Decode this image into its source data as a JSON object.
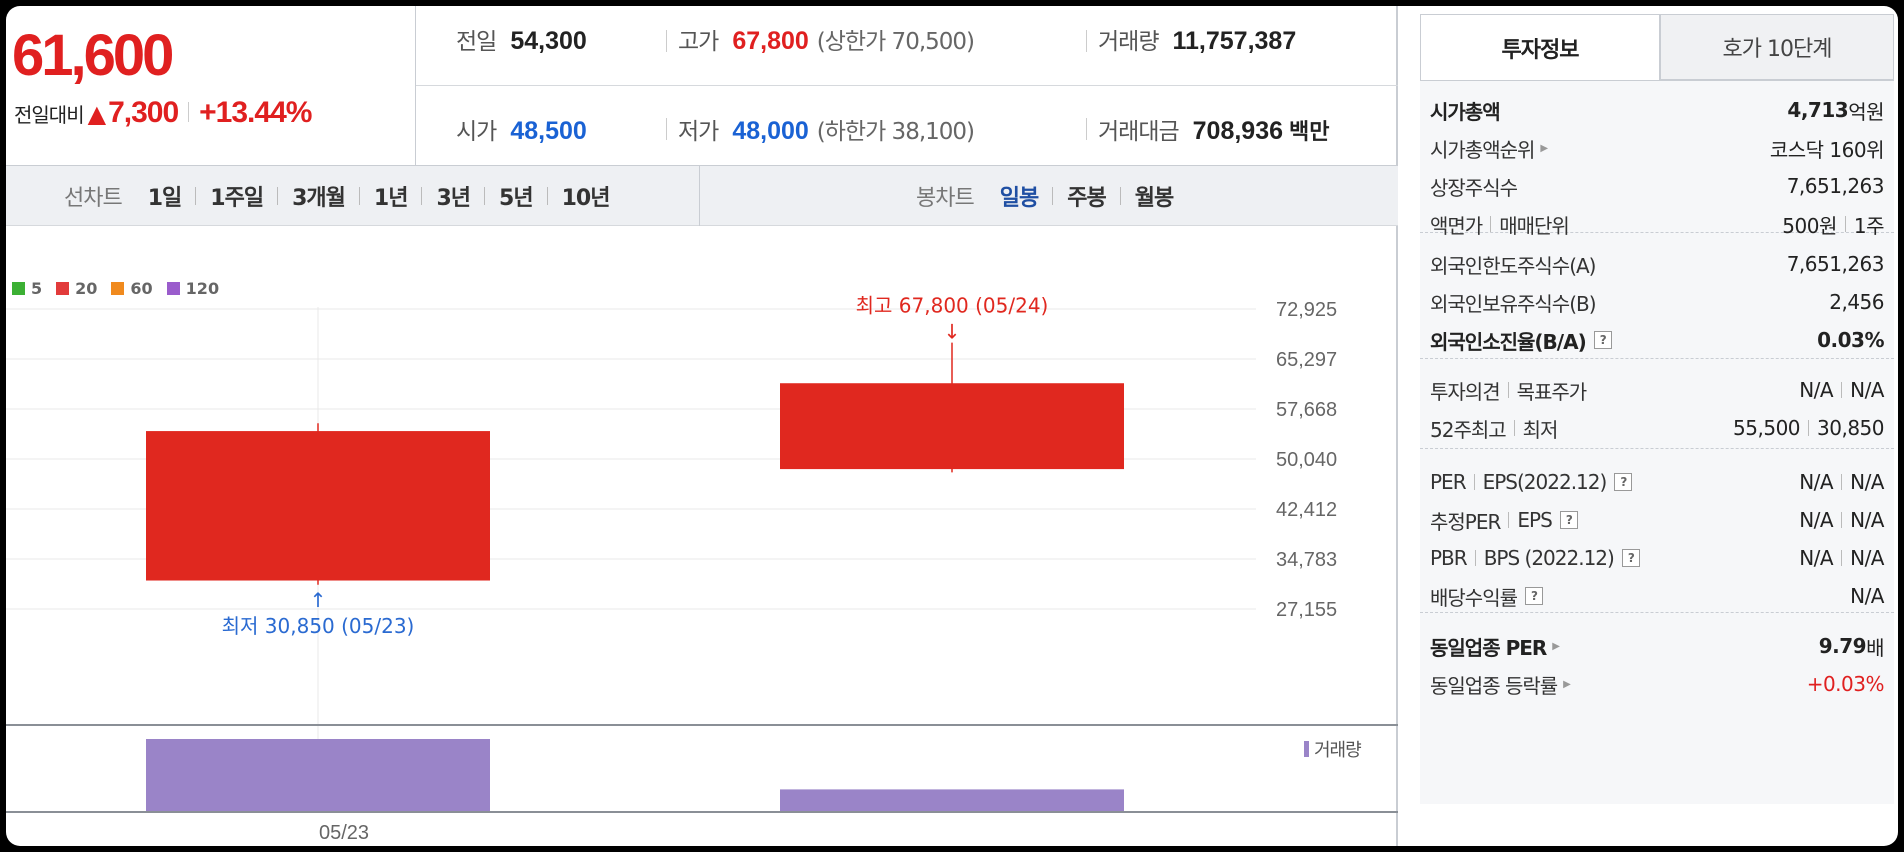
{
  "quote": {
    "price": "61,600",
    "change_label": "전일대비",
    "change_arrow": "▲",
    "change_amount": "7,300",
    "change_rate": "+13.44%",
    "prev_label": "전일",
    "prev_value": "54,300",
    "high_label": "고가",
    "high_value": "67,800",
    "upper_limit": "(상한가 70,500)",
    "volume_label": "거래량",
    "volume_value": "11,757,387",
    "open_label": "시가",
    "open_value": "48,500",
    "low_label": "저가",
    "low_value": "48,000",
    "lower_limit": "(하한가 38,100)",
    "amount_label": "거래대금",
    "amount_value": "708,936",
    "amount_unit": "백만"
  },
  "toolbar": {
    "line_title": "선차트",
    "periods": [
      "1일",
      "1주일",
      "3개월",
      "1년",
      "3년",
      "5년",
      "10년"
    ],
    "candle_title": "봉차트",
    "candles": [
      "일봉",
      "주봉",
      "월봉"
    ],
    "active_candle": "일봉"
  },
  "legend": [
    {
      "label": "5",
      "color": "#3cb034"
    },
    {
      "label": "20",
      "color": "#e23b3b"
    },
    {
      "label": "60",
      "color": "#f08a1e"
    },
    {
      "label": "120",
      "color": "#9a5ccc"
    }
  ],
  "chart_data": {
    "type": "candlestick",
    "y_ticks": [
      "72,925",
      "65,297",
      "57,668",
      "50,040",
      "42,412",
      "34,783",
      "27,155"
    ],
    "ylim": [
      27155,
      72925
    ],
    "candles": [
      {
        "date": "05/23",
        "open": 31500,
        "high": 55500,
        "low": 30850,
        "close": 54300,
        "color": "#e0281f",
        "volume": 1.0
      },
      {
        "date": "05/24",
        "open": 48500,
        "high": 67800,
        "low": 48000,
        "close": 61600,
        "color": "#e0281f",
        "volume": 0.3
      }
    ],
    "annotations": {
      "high_label": "최고 67,800 (05/24)",
      "low_label": "최저 30,850 (05/23)",
      "high_arrow": "↓",
      "low_arrow": "↑"
    },
    "x_label": "05/23",
    "volume_label": "거래량",
    "volume_color": "#9a84c8"
  },
  "side": {
    "tabs": [
      "투자정보",
      "호가 10단계"
    ],
    "market_cap_label": "시가총액",
    "market_cap_value": "4,713",
    "market_cap_unit": "억원",
    "rank_label": "시가총액순위",
    "rank_value": "코스닥 160위",
    "shares_label": "상장주식수",
    "shares_value": "7,651,263",
    "face_label": "액면가",
    "unit_label": "매매단위",
    "face_value": "500원",
    "unit_value": "1주",
    "foreign_limit_label": "외국인한도주식수(A)",
    "foreign_limit_value": "7,651,263",
    "foreign_hold_label": "외국인보유주식수(B)",
    "foreign_hold_value": "2,456",
    "foreign_ratio_label": "외국인소진율(B/A)",
    "foreign_ratio_value": "0.03%",
    "opinion_label": "투자의견",
    "target_label": "목표주가",
    "opinion_value": "N/A",
    "target_value": "N/A",
    "w52_high_label": "52주최고",
    "w52_low_label": "최저",
    "w52_high_value": "55,500",
    "w52_low_value": "30,850",
    "per_label": "PER",
    "eps_label": "EPS(2022.12)",
    "per_value": "N/A",
    "eps_value": "N/A",
    "est_per_label": "추정PER",
    "est_eps_label": "EPS",
    "est_per_value": "N/A",
    "est_eps_value": "N/A",
    "pbr_label": "PBR",
    "bps_label": "BPS (2022.12)",
    "pbr_value": "N/A",
    "bps_value": "N/A",
    "div_label": "배당수익률",
    "div_value": "N/A",
    "sector_per_label": "동일업종 PER",
    "sector_per_value": "9.79",
    "sector_per_unit": "배",
    "sector_rate_label": "동일업종 등락률",
    "sector_rate_value": "+0.03%"
  }
}
